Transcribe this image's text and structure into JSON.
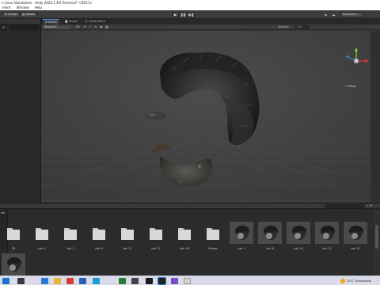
{
  "window": {
    "title": "s Linux Standalone - Unity 2020.1.4f1 Personal* <DX11>"
  },
  "menu": [
    "ment",
    "Window",
    "Help"
  ],
  "toolbar": {
    "buttons": [
      {
        "label": "Center"
      },
      {
        "label": "Global"
      }
    ],
    "play_glyphs": {
      "play": "▶",
      "pause": "❚❚",
      "step": "▶❚"
    },
    "account_label": "Account",
    "cloud_icon": "☁"
  },
  "hierarchy": {
    "menu_glyph": "⋮",
    "add_glyph": "+"
  },
  "scene": {
    "tabs": [
      {
        "label": "Scene",
        "icon": "#"
      },
      {
        "label": "Game",
        "icon": "◙"
      },
      {
        "label": "Asset Store",
        "icon": "🛒"
      }
    ],
    "shading_mode": "Shaded",
    "mode_2d": "2D",
    "tool_icons": [
      "☀",
      "♪",
      "✦",
      "◉",
      "▦"
    ],
    "gizmos_label": "Gizmos",
    "search_placeholder": "All",
    "view_label": "< Persp"
  },
  "project": {
    "left_label": "ets",
    "tab_icons": [
      "+",
      "☰"
    ],
    "assets": [
      {
        "name": "3D",
        "kind": "folder"
      },
      {
        "name": "hair 1",
        "kind": "folder"
      },
      {
        "name": "hair 2",
        "kind": "folder"
      },
      {
        "name": "hair 6",
        "kind": "folder"
      },
      {
        "name": "hair 11",
        "kind": "folder"
      },
      {
        "name": "hair 12",
        "kind": "folder"
      },
      {
        "name": "hair 16",
        "kind": "folder"
      },
      {
        "name": "Scenes",
        "kind": "folder"
      },
      {
        "name": "hair 1",
        "kind": "hair"
      },
      {
        "name": "hair 6",
        "kind": "hair"
      },
      {
        "name": "hair 10",
        "kind": "hair"
      },
      {
        "name": "hair 11",
        "kind": "hair"
      },
      {
        "name": "hair 13",
        "kind": "hair"
      },
      {
        "name": "",
        "kind": "hair"
      }
    ]
  },
  "taskbar": {
    "temperature": "23°C",
    "weather": "Ensolarado",
    "tray_icons": [
      "^",
      "◐",
      "♪"
    ]
  },
  "colors": {
    "accent": "#4a8be0",
    "folder": "#c9c9c9",
    "gizmo_x": "#d63c3c",
    "gizmo_y": "#8ad33a",
    "gizmo_z": "#3b7de0"
  }
}
